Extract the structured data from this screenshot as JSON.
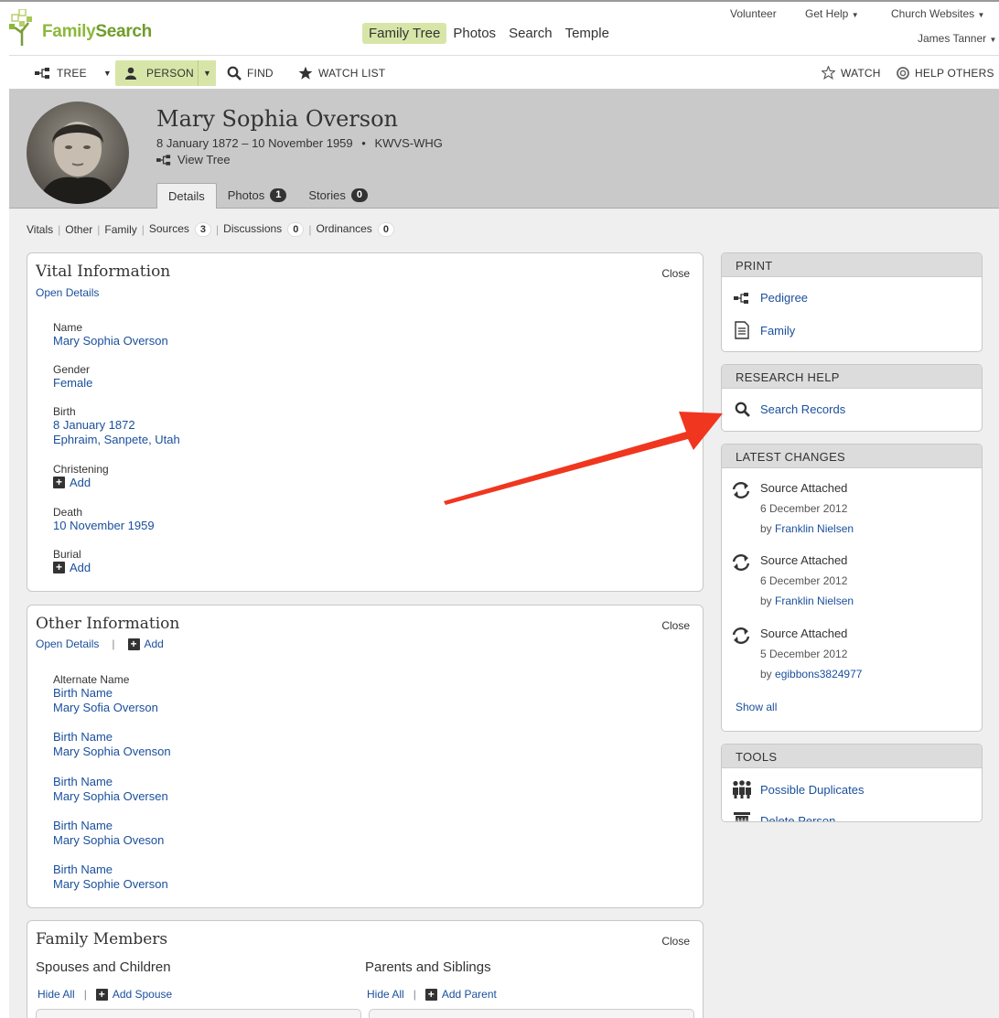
{
  "brand": {
    "name_part1": "Family",
    "name_part2": "Search"
  },
  "main_nav": [
    "Family Tree",
    "Photos",
    "Search",
    "Temple"
  ],
  "util_nav": {
    "volunteer": "Volunteer",
    "get_help": "Get Help",
    "church_websites": "Church Websites",
    "user": "James Tanner"
  },
  "toolbar": {
    "tree": "TREE",
    "person": "PERSON",
    "find": "FIND",
    "watch_list": "WATCH LIST",
    "watch": "WATCH",
    "help_others": "HELP OTHERS"
  },
  "person": {
    "name": "Mary Sophia Overson",
    "dates": "8 January 1872 – 10 November 1959",
    "id": "KWVS-WHG",
    "view_tree": "View Tree",
    "tabs": {
      "details": "Details",
      "photos": "Photos",
      "photos_count": "1",
      "stories": "Stories",
      "stories_count": "0"
    }
  },
  "subnav": {
    "vitals": "Vitals",
    "other": "Other",
    "family": "Family",
    "sources": "Sources",
    "sources_count": "3",
    "discussions": "Discussions",
    "discussions_count": "0",
    "ordinances": "Ordinances",
    "ordinances_count": "0"
  },
  "vital": {
    "title": "Vital Information",
    "close": "Close",
    "open_details": "Open Details",
    "name_label": "Name",
    "name_value": "Mary Sophia Overson",
    "gender_label": "Gender",
    "gender_value": "Female",
    "birth_label": "Birth",
    "birth_date": "8 January 1872",
    "birth_place": "Ephraim, Sanpete, Utah",
    "christening_label": "Christening",
    "death_label": "Death",
    "death_date": "10 November 1959",
    "burial_label": "Burial",
    "add": "Add"
  },
  "other": {
    "title": "Other Information",
    "close": "Close",
    "open_details": "Open Details",
    "add": "Add",
    "alt_label": "Alternate Name",
    "names": [
      {
        "type": "Birth Name",
        "value": "Mary Sofia Overson"
      },
      {
        "type": "Birth Name",
        "value": "Mary Sophia Ovenson"
      },
      {
        "type": "Birth Name",
        "value": "Mary Sophia Oversen"
      },
      {
        "type": "Birth Name",
        "value": "Mary Sophia Oveson"
      },
      {
        "type": "Birth Name",
        "value": "Mary Sophie Overson"
      }
    ]
  },
  "family": {
    "title": "Family Members",
    "close": "Close",
    "spouses_title": "Spouses and Children",
    "parents_title": "Parents and Siblings",
    "hide_all": "Hide All",
    "add_spouse": "Add Spouse",
    "add_parent": "Add Parent"
  },
  "print": {
    "title": "PRINT",
    "pedigree": "Pedigree",
    "family": "Family"
  },
  "research": {
    "title": "RESEARCH HELP",
    "search_records": "Search Records"
  },
  "latest": {
    "title": "LATEST CHANGES",
    "items": [
      {
        "title": "Source Attached",
        "date": "6 December 2012",
        "by": "by",
        "user": "Franklin Nielsen"
      },
      {
        "title": "Source Attached",
        "date": "6 December 2012",
        "by": "by",
        "user": "Franklin Nielsen"
      },
      {
        "title": "Source Attached",
        "date": "5 December 2012",
        "by": "by",
        "user": "egibbons3824977"
      }
    ],
    "show_all": "Show all"
  },
  "tools": {
    "title": "TOOLS",
    "duplicates": "Possible Duplicates",
    "delete": "Delete Person"
  },
  "colors": {
    "link": "#1a4f9c",
    "accent_green": "#d7e6a8",
    "brand_green": "#8cb83b",
    "annotation_arrow": "#f0361f"
  }
}
